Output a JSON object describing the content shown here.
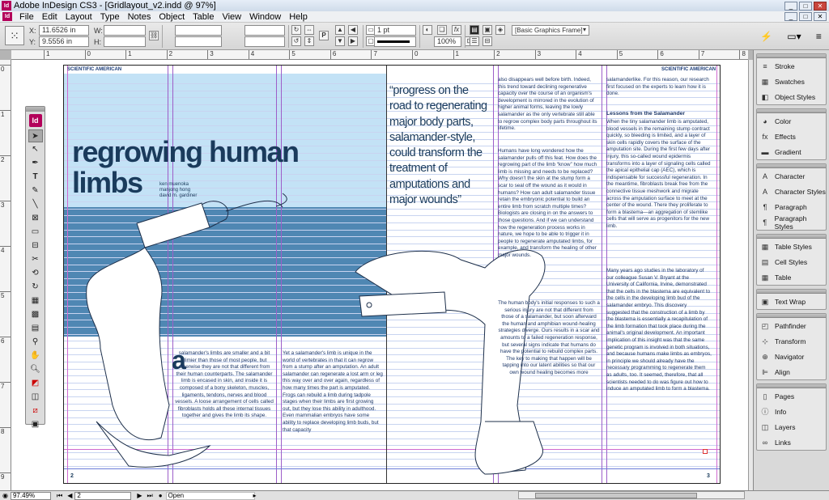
{
  "window": {
    "title": "Adobe InDesign CS3 - [Gridlayout_v2.indd @ 97%]",
    "app_icon": "Id"
  },
  "menu": [
    "File",
    "Edit",
    "Layout",
    "Type",
    "Notes",
    "Object",
    "Table",
    "View",
    "Window",
    "Help"
  ],
  "control": {
    "x_label": "X:",
    "x_value": "11.6526 in",
    "y_label": "Y:",
    "y_value": "9.5556 in",
    "w_label": "W:",
    "h_label": "H:",
    "stroke_weight": "1 pt",
    "opacity": "100%",
    "object_style": "[Basic Graphics Frame]"
  },
  "ruler": {
    "h_ticks": [
      "1",
      "0",
      "1",
      "2",
      "3",
      "4",
      "5",
      "6",
      "7",
      "0",
      "1",
      "2",
      "3",
      "4",
      "5",
      "6",
      "7",
      "8"
    ],
    "v_ticks": [
      "0",
      "1",
      "2",
      "3",
      "4",
      "5",
      "6",
      "7",
      "8",
      "9"
    ]
  },
  "document": {
    "folio_left": "SCIENTIFIC AMERICAN",
    "folio_right": "SCIENTIFIC AMERICAN",
    "headline_1": "regrowing human",
    "headline_2": "limbs",
    "byline_1": "ken muenoka",
    "byline_2": "manjong hong",
    "byline_3": "david m. gardiner",
    "pullquote": "“progress on the road to regenerating major body parts, salamander-style, could transform the treatment of amputations and major wounds”",
    "dropcap": "a",
    "col1": "salamander's limbs are smaller and a bit slimier than those of most people, but otherwise they are not that different from their human counterparts. The salamander limb is encased in skin, and inside it is composed of a bony skeleton, muscles, ligaments, tendons, nerves and blood vessels. A loose arrangement of cells called fibroblasts holds all these internal tissues together and gives the limb its shape.",
    "col2": "Yet a salamander's limb is unique in the world of vertebrates in that it can regrow from a stump after an amputation. An adult salamander can regenerate a lost arm or leg this way over and over again, regardless of how many times the part is amputated. Frogs can rebuild a limb during tadpole stages when their limbs are first growing out, but they lose this ability in adulthood. Even mammalian embryos have some ability to replace developing limb buds, but that capacity",
    "col3a": "also disappears well before birth. Indeed, this trend toward declining regenerative capacity over the course of an organism's development is mirrored in the evolution of higher animal forms, leaving the lowly salamander as the only vertebrate still able to regrow complex body parts throughout its lifetime.",
    "col3b": "Humans have long wondered how the salamander pulls off this feat. How does the regrowing part of the limb “know” how much limb is missing and needs to be replaced? Why doesn't the skin at the stump form a scar to seal off the wound as it would in humans? How can adult salamander tissue retain the embryonic potential to build an entire limb from scratch multiple times? Biologists are closing in on the answers to those questions. And if we can understand how the regeneration process works in nature, we hope to be able to trigger it in people to regenerate amputated limbs, for example, and transform the healing of other major wounds.",
    "col3c": "The human body's initial responses to such a serious injury are not that different from those of a salamander, but soon afterward the human and amphibian wound-healing strategies diverge. Ours results in a scar and amounts to a failed regeneration response, but several signs indicate that humans do have the potential to rebuild complex parts. The key to making that happen will be tapping into our latent abilities so that our own wound healing becomes more",
    "col4a": "salamanderlike. For this reason, our research first focused on the experts to learn how it is done.",
    "col4_subhead": "Lessons from the Salamander",
    "col4b": "When the tiny salamander limb is amputated, blood vessels in the remaining stump contract quickly, so bleeding is limited, and a layer of skin cells rapidly covers the surface of the amputation site. During the first few days after injury, this so-called wound epidermis transforms into a layer of signaling cells called the apical epithelial cap (AEC), which is indispensable for successful regeneration. In the meantime, fibroblasts break free from the connective tissue meshwork and migrate across the amputation surface to meet at the center of the wound. There they proliferate to form a blastema—an aggregation of stemlike cells that will serve as progenitors for the new limb.",
    "col4c": "Many years ago studies in the laboratory of our colleague Susan V. Bryant at the University of California, Irvine, demonstrated that the cells in the blastema are equivalent to the cells in the developing limb bud of the salamander embryo. This discovery suggested that the construction of a limb by the blastema is essentially a recapitulation of the limb formation that took place during the animal's original development. An important implication of this insight was that the same genetic program is involved in both situations, and because humans make limbs as embryos, in principle we should already have the necessary programming to regenerate them as adults, too. It seemed, therefore, that all scientists needed to do was figure out how to induce an amputated limb to form a blastema.",
    "page_left": "2",
    "page_right": "3"
  },
  "panels": [
    {
      "group": "stroke",
      "items": [
        {
          "label": "Stroke",
          "icon": "stroke-icon"
        },
        {
          "label": "Swatches",
          "icon": "swatches-icon"
        },
        {
          "label": "Object Styles",
          "icon": "object-styles-icon"
        }
      ]
    },
    {
      "group": "color",
      "items": [
        {
          "label": "Color",
          "icon": "color-icon"
        },
        {
          "label": "Effects",
          "icon": "effects-icon"
        },
        {
          "label": "Gradient",
          "icon": "gradient-icon"
        }
      ]
    },
    {
      "group": "type",
      "items": [
        {
          "label": "Character",
          "icon": "character-icon"
        },
        {
          "label": "Character Styles",
          "icon": "character-styles-icon"
        },
        {
          "label": "Paragraph",
          "icon": "paragraph-icon"
        },
        {
          "label": "Paragraph Styles",
          "icon": "paragraph-styles-icon"
        }
      ]
    },
    {
      "group": "table",
      "items": [
        {
          "label": "Table Styles",
          "icon": "table-styles-icon"
        },
        {
          "label": "Cell Styles",
          "icon": "cell-styles-icon"
        },
        {
          "label": "Table",
          "icon": "table-icon"
        }
      ]
    },
    {
      "group": "wrap",
      "items": [
        {
          "label": "Text Wrap",
          "icon": "text-wrap-icon"
        }
      ]
    },
    {
      "group": "transform",
      "items": [
        {
          "label": "Pathfinder",
          "icon": "pathfinder-icon"
        },
        {
          "label": "Transform",
          "icon": "transform-icon"
        },
        {
          "label": "Navigator",
          "icon": "navigator-icon"
        },
        {
          "label": "Align",
          "icon": "align-icon"
        }
      ]
    },
    {
      "group": "pages",
      "items": [
        {
          "label": "Pages",
          "icon": "pages-icon"
        },
        {
          "label": "Info",
          "icon": "info-icon"
        },
        {
          "label": "Layers",
          "icon": "layers-icon"
        },
        {
          "label": "Links",
          "icon": "links-icon"
        }
      ]
    }
  ],
  "status": {
    "zoom": "97.49%",
    "page": "2",
    "state": "Open"
  },
  "colors": {
    "brand": "#b3005a",
    "light_blue": "#c3e2f6",
    "mid_blue": "#4f87b3",
    "text_navy": "#1a3b5c",
    "column_guide": "#9d5ec9",
    "baseline_grid": "#c8d4f0"
  }
}
